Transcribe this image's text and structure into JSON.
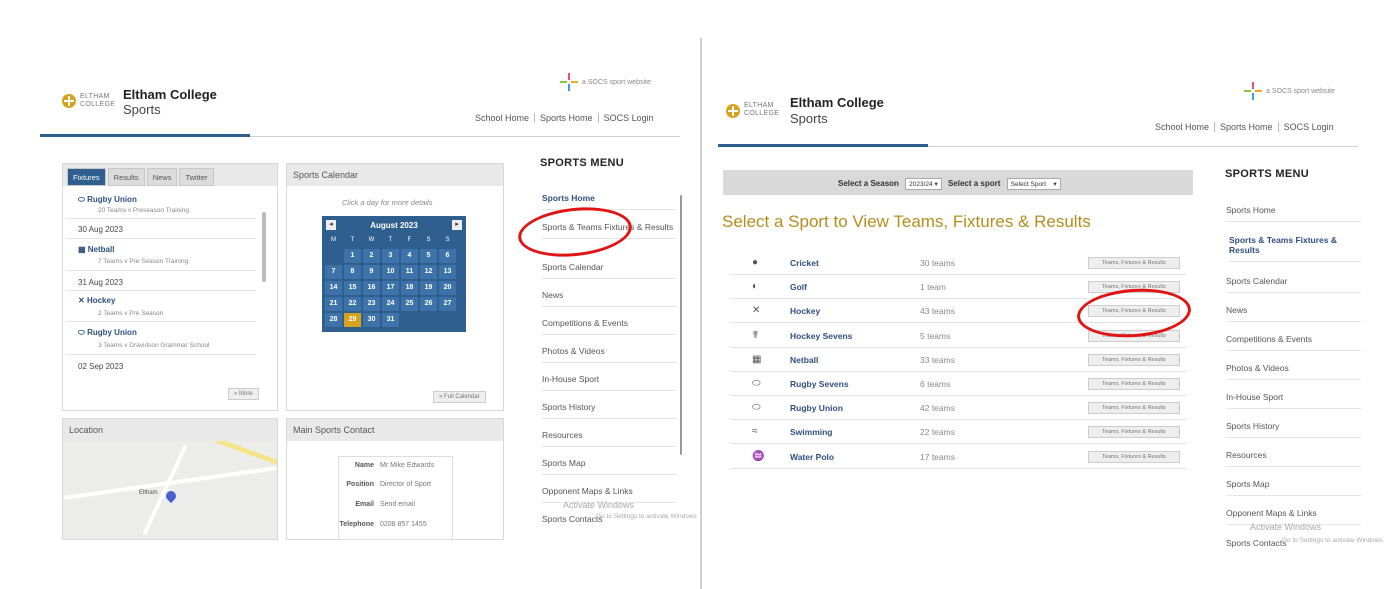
{
  "left": {
    "brand_small": "ELTHAM COLLEGE",
    "title": "Eltham College",
    "subtitle": "Sports",
    "socs": "a SOCS sport website",
    "links": [
      "School Home",
      "Sports Home",
      "SOCS Login"
    ],
    "menu_title": "SPORTS MENU",
    "menu": [
      "Sports Home",
      "Sports & Teams Fixtures & Results",
      "Sports Calendar",
      "News",
      "Competitions & Events",
      "Photos & Videos",
      "In-House Sport",
      "Sports History",
      "Resources",
      "Sports Map",
      "Opponent Maps & Links",
      "Sports Contacts"
    ],
    "watermark": "Activate Windows",
    "watermark2": "Go to Settings to activate Windows",
    "tabs": [
      "Fixtures",
      "Results",
      "News",
      "Twitter"
    ],
    "fixtures": [
      {
        "sport": "Rugby Union",
        "detail": "20 Teams v Preseason Training"
      },
      {
        "date": "30 Aug 2023"
      },
      {
        "sport": "Netball",
        "detail": "7 Teams v Pre Season Training"
      },
      {
        "date": "31 Aug 2023"
      },
      {
        "sport": "Hockey",
        "detail": "2 Teams v Pre Season"
      },
      {
        "sport": "Rugby Union",
        "detail": "3 Teams v Dravidson Grammar School"
      },
      {
        "date": "02 Sep 2023"
      }
    ],
    "more": "» More",
    "calendar_head": "Sports Calendar",
    "calendar_hint": "Click a day for more details",
    "calendar_month": "August 2023",
    "dow": [
      "M",
      "T",
      "W",
      "T",
      "F",
      "S",
      "S"
    ],
    "days": [
      "",
      "1",
      "2",
      "3",
      "4",
      "5",
      "6",
      "7",
      "8",
      "9",
      "10",
      "11",
      "12",
      "13",
      "14",
      "15",
      "16",
      "17",
      "18",
      "19",
      "20",
      "21",
      "22",
      "23",
      "24",
      "25",
      "26",
      "27",
      "28",
      "29",
      "30",
      "31"
    ],
    "today": "29",
    "full_calendar": "» Full Calendar",
    "location_head": "Location",
    "map_label": "Eltham",
    "contact_head": "Main Sports Contact",
    "contact": [
      {
        "label": "Name",
        "value": "Mr Mike Edwards"
      },
      {
        "label": "Position",
        "value": "Director of Sport"
      },
      {
        "label": "Email",
        "value": "Send email"
      },
      {
        "label": "Telephone",
        "value": "0208 857 1455"
      }
    ]
  },
  "right": {
    "brand_small": "ELTHAM COLLEGE",
    "title": "Eltham College",
    "subtitle": "Sports",
    "socs": "a SOCS sport website",
    "links": [
      "School Home",
      "Sports Home",
      "SOCS Login"
    ],
    "filter_season_label": "Select a Season",
    "filter_season_value": "2023/24",
    "filter_sport_label": "Select a sport",
    "filter_sport_value": "Select Sport",
    "heading": "Select a Sport to View Teams, Fixtures & Results",
    "button_label": "Teams, Fixtures & Results",
    "sports": [
      {
        "name": "Cricket",
        "teams": "30 teams",
        "icon": "cricket-ball-icon",
        "glyph": "●"
      },
      {
        "name": "Golf",
        "teams": "1 team",
        "icon": "golf-ball-icon",
        "glyph": "◐"
      },
      {
        "name": "Hockey",
        "teams": "43 teams",
        "icon": "hockey-sticks-icon",
        "glyph": "✕"
      },
      {
        "name": "Hockey Sevens",
        "teams": "5 teams",
        "icon": "hockey-player-icon",
        "glyph": "☤"
      },
      {
        "name": "Netball",
        "teams": "33 teams",
        "icon": "netball-icon",
        "glyph": "▦"
      },
      {
        "name": "Rugby Sevens",
        "teams": "6 teams",
        "icon": "rugby-ball-icon",
        "glyph": "⬭"
      },
      {
        "name": "Rugby Union",
        "teams": "42 teams",
        "icon": "rugby-ball-icon",
        "glyph": "⬭"
      },
      {
        "name": "Swimming",
        "teams": "22 teams",
        "icon": "swimmer-icon",
        "glyph": "≈"
      },
      {
        "name": "Water Polo",
        "teams": "17 teams",
        "icon": "water-polo-icon",
        "glyph": "♒"
      }
    ],
    "menu_title": "SPORTS MENU",
    "menu": [
      "Sports Home",
      "Sports & Teams Fixtures & Results",
      "Sports Calendar",
      "News",
      "Competitions & Events",
      "Photos & Videos",
      "In-House Sport",
      "Sports History",
      "Resources",
      "Sports Map",
      "Opponent Maps & Links",
      "Sports Contacts"
    ],
    "watermark": "Activate Windows",
    "watermark2": "Go to Settings to activate Windows"
  },
  "colors": {
    "accent": "#2f5f8f",
    "gold": "#b58d1e",
    "annotation": "#e01414"
  }
}
